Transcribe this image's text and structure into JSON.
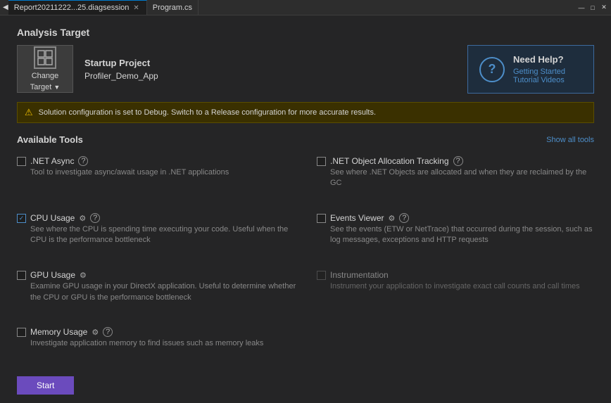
{
  "titleBar": {
    "tabs": [
      {
        "label": "Report20211222...25.diagsession",
        "active": true,
        "closable": true
      },
      {
        "label": "Program.cs",
        "active": false,
        "closable": false
      }
    ],
    "scrollArrowLeft": "◀",
    "scrollArrowRight": "▶",
    "windowControlMin": "—",
    "windowControlMax": "□",
    "windowControlClose": "✕"
  },
  "analysisTarget": {
    "sectionTitle": "Analysis Target",
    "changeTarget": {
      "iconSymbol": "⊞",
      "label": "Change",
      "subLabel": "Target",
      "dropdownArrow": "▼"
    },
    "startupProject": {
      "title": "Startup Project",
      "value": "Profiler_Demo_App"
    }
  },
  "needHelp": {
    "iconSymbol": "?",
    "title": "Need Help?",
    "links": [
      {
        "label": "Getting Started"
      },
      {
        "label": "Tutorial Videos"
      }
    ]
  },
  "warning": {
    "icon": "⚠",
    "text": "Solution configuration is set to Debug. Switch to a Release configuration for more accurate results."
  },
  "availableTools": {
    "title": "Available Tools",
    "showAllLabel": "Show all tools",
    "tools": [
      {
        "id": "dotnet-async",
        "name": ".NET Async",
        "checked": false,
        "disabled": false,
        "hasGear": false,
        "hasHelp": true,
        "description": "Tool to investigate async/await usage in .NET applications",
        "column": "left"
      },
      {
        "id": "dotnet-object-allocation",
        "name": ".NET Object Allocation Tracking",
        "checked": false,
        "disabled": false,
        "hasGear": false,
        "hasHelp": true,
        "description": "See where .NET Objects are allocated and when they are reclaimed by the GC",
        "column": "right"
      },
      {
        "id": "cpu-usage",
        "name": "CPU Usage",
        "checked": true,
        "disabled": false,
        "hasGear": true,
        "hasHelp": true,
        "description": "See where the CPU is spending time executing your code. Useful when the CPU is the performance bottleneck",
        "column": "left"
      },
      {
        "id": "events-viewer",
        "name": "Events Viewer",
        "checked": false,
        "disabled": false,
        "hasGear": true,
        "hasHelp": true,
        "description": "See the events (ETW or NetTrace) that occurred during the session, such as log messages, exceptions and HTTP requests",
        "column": "right"
      },
      {
        "id": "gpu-usage",
        "name": "GPU Usage",
        "checked": false,
        "disabled": false,
        "hasGear": true,
        "hasHelp": false,
        "description": "Examine GPU usage in your DirectX application. Useful to determine whether the CPU or GPU is the performance bottleneck",
        "column": "left"
      },
      {
        "id": "instrumentation",
        "name": "Instrumentation",
        "checked": false,
        "disabled": true,
        "hasGear": false,
        "hasHelp": false,
        "description": "Instrument your application to investigate exact call counts and call times",
        "column": "right"
      },
      {
        "id": "memory-usage",
        "name": "Memory Usage",
        "checked": false,
        "disabled": false,
        "hasGear": true,
        "hasHelp": true,
        "description": "Investigate application memory to find issues such as memory leaks",
        "column": "left"
      }
    ]
  },
  "bottomBar": {
    "startLabel": "Start"
  }
}
